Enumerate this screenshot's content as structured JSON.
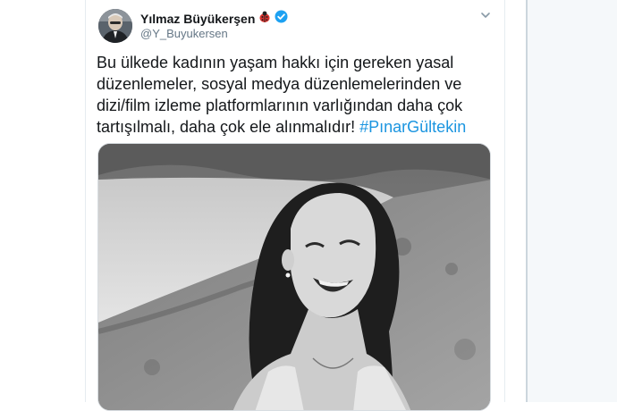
{
  "tweet": {
    "author_name": "Yılmaz Büyükerşen",
    "author_handle": "@Y_Buyukersen",
    "text_lines": [
      "Bu ülkede kadının yaşam hakkı için gereken yasal",
      "düzenlemeler,  sosyal medya düzenlemelerinden ve",
      "dizi/film izleme platformlarının varlığından daha çok",
      "tartışılmalı, daha çok ele alınmalıdır!"
    ],
    "hashtag": "#PınarGültekin"
  },
  "icons": {
    "verified": "verified-badge-icon",
    "ladybug": "ladybug-emoji-icon",
    "menu": "chevron-down-icon"
  },
  "colors": {
    "hashtag": "#1b95e0",
    "verified": "#1da1f2",
    "text": "#14171a",
    "secondary": "#657786"
  }
}
